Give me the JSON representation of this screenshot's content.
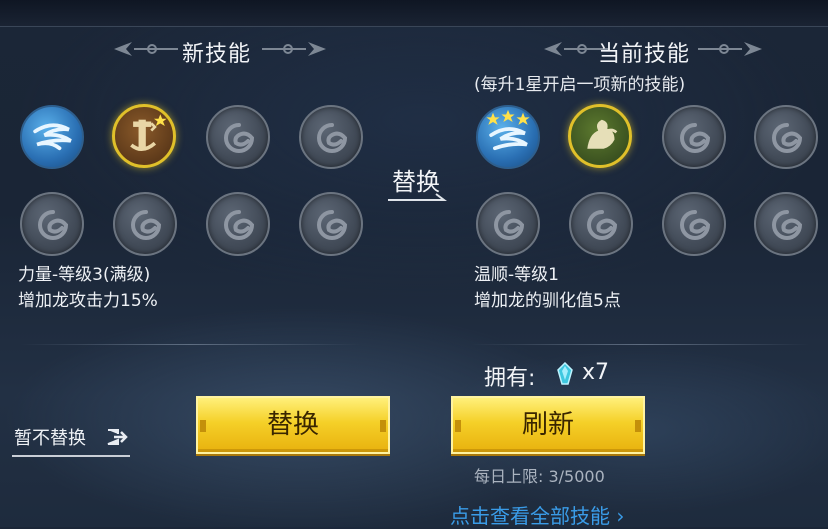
{
  "header": {
    "new_skill_title": "新技能",
    "current_skill_title": "当前技能",
    "current_skill_note": "(每升1星开启一项新的技能)"
  },
  "new_skills": {
    "selected": {
      "name_level": "力量-等级3(满级)",
      "effect": "增加龙攻击力15%"
    }
  },
  "current_skills": {
    "selected": {
      "name_level": "温顺-等级1",
      "effect": "增加龙的驯化值5点"
    }
  },
  "swap_label": "替换",
  "inventory": {
    "label": "拥有:",
    "count": "x7"
  },
  "buttons": {
    "replace": "替换",
    "refresh": "刷新",
    "skip": "暂不替换"
  },
  "daily_limit": "每日上限: 3/5000",
  "view_all_link": "点击查看全部技能",
  "colors": {
    "accent_gold": "#f5d028",
    "link_blue": "#3a9ce8",
    "empty_slot": "#4a5360"
  }
}
